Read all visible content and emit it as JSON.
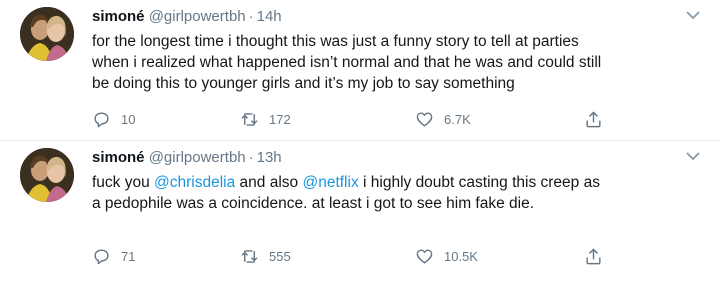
{
  "tweets": [
    {
      "display_name": "simoné",
      "handle": "@girlpowertbh",
      "separator": "·",
      "time": "14h",
      "text_lines": [
        "for the longest time i thought this was just a funny story to tell at parties",
        "when i realized what happened isn’t normal and that he was and could still",
        "be doing this to younger girls and it’s my job to say something"
      ],
      "replies": "10",
      "retweets": "172",
      "likes": "6.7K"
    },
    {
      "display_name": "simoné",
      "handle": "@girlpowertbh",
      "separator": "·",
      "time": "13h",
      "text_parts": {
        "p1": "fuck you ",
        "mention1": "@chrisdelia",
        "p2": " and also ",
        "mention2": "@netflix",
        "p3": " i highly doubt casting this creep as",
        "line2": "a pedophile was a coincidence. at least i got to see him fake die."
      },
      "replies": "71",
      "retweets": "555",
      "likes": "10.5K"
    }
  ],
  "icons": {
    "more": "chevron-down-icon",
    "reply": "reply-icon",
    "retweet": "retweet-icon",
    "like": "heart-icon",
    "share": "share-icon"
  },
  "colors": {
    "link": "#1b95e0",
    "secondary_text": "#657786"
  }
}
